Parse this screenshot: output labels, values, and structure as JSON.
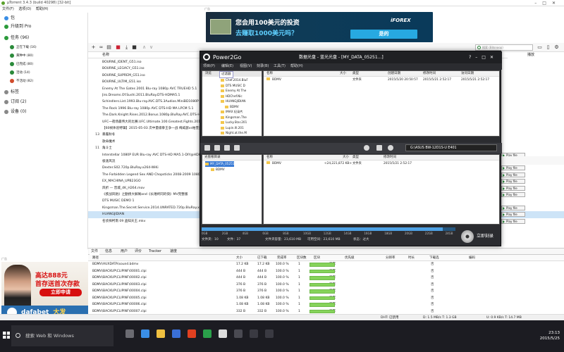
{
  "utorrent": {
    "title": "µTorrent 3.4.3  (build 40298) [32-bit]",
    "menu": [
      "文件(F)",
      "选项(O)",
      "帮助(H)"
    ],
    "sidebar": [
      {
        "label": "包",
        "level": "main",
        "color": "#3a8ee6"
      },
      {
        "label": "升级到 Pro",
        "level": "main",
        "color": "#2a9a3a"
      },
      {
        "label": "任务 (96)",
        "level": "main",
        "color": "#2a9a3a"
      },
      {
        "label": "正在下载 (16)",
        "level": "sub",
        "color": "#2a8a3a"
      },
      {
        "label": "黄种中 (80)",
        "level": "sub",
        "color": "#2a8a3a"
      },
      {
        "label": "已完成 (80)",
        "level": "sub",
        "color": "#2a8a3a"
      },
      {
        "label": "活动 (14)",
        "level": "sub",
        "color": "#2a8a3a"
      },
      {
        "label": "不活动 (82)",
        "level": "sub",
        "color": "#d04a2a"
      },
      {
        "label": "标签",
        "level": "main",
        "color": "#888888"
      },
      {
        "label": "订阅 (2)",
        "level": "main",
        "color": "#888888"
      },
      {
        "label": "设备 (0)",
        "level": "main",
        "color": "#888888"
      }
    ],
    "search_placeholder": "搜索 (Bitsnoop)",
    "list_header": "名称",
    "right_header": "播放",
    "torrents": [
      {
        "n": "",
        "name": "BOURNE_IDENT_G51.iso"
      },
      {
        "n": "",
        "name": "BOURNE_LEGACY_G51.iso"
      },
      {
        "n": "",
        "name": "BOURNE_SUPREM_G51.iso"
      },
      {
        "n": "",
        "name": "BOURNE_ULTIM_G51.iso"
      },
      {
        "n": "",
        "name": "Enemy At The Gates 2001 Blu-ray 1080p AVC TRUEHD 5.1"
      },
      {
        "n": "",
        "name": "Jiro.Dreams.Of.Sushi.2011.BluRay.DTS-HDMA5.1"
      },
      {
        "n": "",
        "name": "Schindlers.List.1993.Blu-ray.AVC.DTS.3Audios.MiniBD1080P"
      },
      {
        "n": "",
        "name": "The Rock 1996 Blu-ray 1080p AVC DTS-HD MA LPCM 5.1"
      },
      {
        "n": "",
        "name": "The.Dark.Knight.Rises.2012.Bonus.1080p.BluRay.AVC.DTS-HD"
      },
      {
        "n": "",
        "name": "UFC一夜场最伟大的比赛.UFC.Ultimate.100.Greatest.Fights.2011"
      },
      {
        "n": "",
        "name": "【60帧体验特辑】2015-05-03 次中量级拳王争一战 梅威瑟vs帕奎奥"
      },
      {
        "n": "13",
        "name": "暴露秋冬"
      },
      {
        "n": "",
        "name": "歌命魔术"
      },
      {
        "n": "11",
        "name": "角斗士"
      },
      {
        "n": "",
        "name": "Interstellar 1080P EUR Blu-ray AVC DTS-HD MA5.1-DIY@HDHome"
      },
      {
        "n": "",
        "name": "极速风流"
      },
      {
        "n": "",
        "name": "Dexter.S02.720p.BluRay.x264-WiKi"
      },
      {
        "n": "",
        "name": "The Forbidden Legend Sex AND Chopsticks 2008-2009 1080p"
      },
      {
        "n": "",
        "name": "EX_MACHINA_UPB23GO"
      },
      {
        "n": "",
        "name": "风折 — 晋城_4K_H264.mov"
      },
      {
        "n": "",
        "name": "《疾战风驰》之勤扬大解阁and《长禧终同的快》MV完整版"
      },
      {
        "n": "",
        "name": "DTS MUSIC DEMO 1"
      },
      {
        "n": "",
        "name": "Kingsman.The.Secret.Service.2014.UNRATED.720p.BluRay.x264"
      },
      {
        "n": "",
        "name": "HUANGJIDIAN"
      },
      {
        "n": "",
        "name": "名侦探柯南 09 盗知天王.mkv"
      }
    ],
    "play_label": "Play file",
    "tabs": [
      "文件",
      "信息",
      "用户",
      "评价",
      "Tracker",
      "速度"
    ],
    "files_headers": [
      "路径",
      "大小",
      "已下载",
      "完成率",
      "区块数",
      "区块",
      "优先级",
      "分辨率",
      "时长",
      "下载选",
      "编码"
    ],
    "files": [
      {
        "path": "BDMV\\AUXDATA\\sound.bdmv",
        "size": "17.2 KB",
        "done": "17.2 KB",
        "pct": "100.0 %",
        "pieces": "1",
        "prio": "正常",
        "sel": "否"
      },
      {
        "path": "BDMV\\BACKUP\\CLIPINF\\00001.clpi",
        "size": "444 B",
        "done": "444 B",
        "pct": "100.0 %",
        "pieces": "1",
        "prio": "正常",
        "sel": "否"
      },
      {
        "path": "BDMV\\BACKUP\\CLIPINF\\00002.clpi",
        "size": "444 B",
        "done": "444 B",
        "pct": "100.0 %",
        "pieces": "1",
        "prio": "正常",
        "sel": "否"
      },
      {
        "path": "BDMV\\BACKUP\\CLIPINF\\00003.clpi",
        "size": "376 B",
        "done": "376 B",
        "pct": "100.0 %",
        "pieces": "1",
        "prio": "正常",
        "sel": "否"
      },
      {
        "path": "BDMV\\BACKUP\\CLIPINF\\00004.clpi",
        "size": "376 B",
        "done": "376 B",
        "pct": "100.0 %",
        "pieces": "1",
        "prio": "正常",
        "sel": "否"
      },
      {
        "path": "BDMV\\BACKUP\\CLIPINF\\00005.clpi",
        "size": "1.08 KB",
        "done": "1.08 KB",
        "pct": "100.0 %",
        "pieces": "1",
        "prio": "正常",
        "sel": "否"
      },
      {
        "path": "BDMV\\BACKUP\\CLIPINF\\00006.clpi",
        "size": "1.08 KB",
        "done": "1.08 KB",
        "pct": "100.0 %",
        "pieces": "1",
        "prio": "正常",
        "sel": "否"
      },
      {
        "path": "BDMV\\BACKUP\\CLIPINF\\00007.clpi",
        "size": "332 B",
        "done": "332 B",
        "pct": "100.0 %",
        "pieces": "1",
        "prio": "正常",
        "sel": "否"
      },
      {
        "path": "BDMV\\BACKUP\\CLIPINF\\00008.clpi",
        "size": "296 B",
        "done": "296 B",
        "pct": "100.0 %",
        "pieces": "1",
        "prio": "正常",
        "sel": "否"
      },
      {
        "path": "BDMV\\BACKUP\\CLIPINF\\00009.clpi",
        "size": "256 B",
        "done": "256 B",
        "pct": "100.0 %",
        "pieces": "1",
        "prio": "正常",
        "sel": "否"
      }
    ],
    "status": {
      "dht": "DHT: 已禁用",
      "down": "D: 1.5 MB/s T: 1.3 GB",
      "up": "U: 0.9 KB/s T: 14.7 MB"
    }
  },
  "ads": {
    "label": "广告",
    "top_line1": "您会用100美元的投资",
    "top_line2": "去赚取1000美元吗？",
    "top_cta": "是的",
    "top_brand": "iFOREX",
    "left_line1": "高达888元",
    "left_line2": "首存送首次存款",
    "left_cta": "立即申请",
    "left_brand": "dafabet",
    "left_brand_cn": "大发"
  },
  "power2go": {
    "app": "Power2Go",
    "disc_title": "数据光盘 - 蓝光光盘 - [MY_DATA_05251...]",
    "menu": [
      "项目(P)",
      "编辑(E)",
      "视图(V)",
      "刻录(B)",
      "工具(T)",
      "帮助(H)"
    ],
    "left_tabs": [
      "浏览",
      "过滤器"
    ],
    "tree": [
      "Chef.2014.BluF",
      "DTS MUSIC D",
      "Enemy At The",
      "HDChef.Nic",
      "HUANGJIDIAN",
      "BDMV",
      "IMAX 纪录片",
      "Kingsman.The",
      "Lucky.Star.201",
      "Lupin.III.201",
      "Night.at.the.M"
    ],
    "top_headers": [
      "名称",
      "大小",
      "类型",
      "创建日期",
      "修改时间",
      "访问日期"
    ],
    "top_row": {
      "name": "BDMV",
      "size": "",
      "type": "文件夹",
      "created": "2015/5/20 20:50:57",
      "modified": "2015/5/21 2:52:17",
      "accessed": "2015/5/21 2:52:17"
    },
    "drive": "G:\\ASUS BW-12D1S-U E401",
    "disc_tree_header": "光盘根目录",
    "disc_tree": [
      "MY_DATA_05251",
      "BDMV"
    ],
    "bottom_headers": [
      "名称",
      "大小",
      "类型",
      "修改时间"
    ],
    "bottom_row": {
      "name": "BDMV",
      "size": "<24,221,872 KB>",
      "type": "文件夹",
      "modified": "2015/5/21 2:52:17"
    },
    "scale": [
      "0GB",
      "2GB",
      "4GB",
      "6GB",
      "8GB",
      "10GB",
      "12GB",
      "14GB",
      "16GB",
      "18GB",
      "20GB",
      "22GB",
      "24GB"
    ],
    "usage_fraction": 0.95,
    "info": {
      "files": "文件夹：10",
      "count": "文件：37",
      "size": "文件夹容量：23,610 MB",
      "free": "可用空间：23,610 MB",
      "status": "状态：过大"
    },
    "burn": "立即刻录"
  },
  "taskbar": {
    "search": "搜索 Web 和 Windows",
    "time": "23:13",
    "date": "2015/5/25"
  }
}
